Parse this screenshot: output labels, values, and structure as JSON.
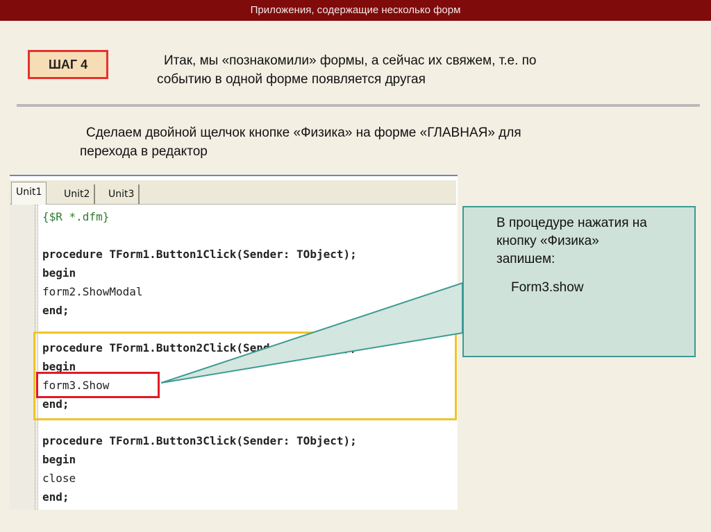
{
  "header": {
    "title": "Приложения, содержащие несколько форм"
  },
  "step": {
    "label": "ШАГ 4"
  },
  "intro": {
    "line1": "Итак, мы «познакомили» формы, а сейчас их свяжем, т.е. по",
    "line2": "событию в одной форме появляется другая"
  },
  "instruction": {
    "line1": "Сделаем двойной щелчок кнопке «Физика» на форме «ГЛАВНАЯ» для",
    "line2": "перехода в редактор"
  },
  "editor": {
    "tabs": [
      "Unit1",
      "Unit2",
      "Unit3"
    ],
    "code": [
      "{$R *.dfm}",
      "procedure TForm1.Button1Click(Sender: TObject);",
      "begin",
      "form2.ShowModal",
      "end;",
      "procedure TForm1.Button2Click(Sender: TObject);",
      "begin",
      "form3.Show",
      "end;",
      "procedure TForm1.Button3Click(Sender: TObject);",
      "begin",
      "close",
      "end;"
    ]
  },
  "callout": {
    "line1": "В процедуре нажатия на",
    "line2": "кнопку «Физика»",
    "line3": "запишем:",
    "code": "Form3.show"
  },
  "colors": {
    "header_bg": "#7f0b0b",
    "badge_border": "#e4322e",
    "badge_fill": "#f7ddb5",
    "highlight_yellow": "#f0c42a",
    "highlight_red": "#e01a24",
    "callout_fill": "#cfe2d9",
    "callout_border": "#3c9a94"
  }
}
